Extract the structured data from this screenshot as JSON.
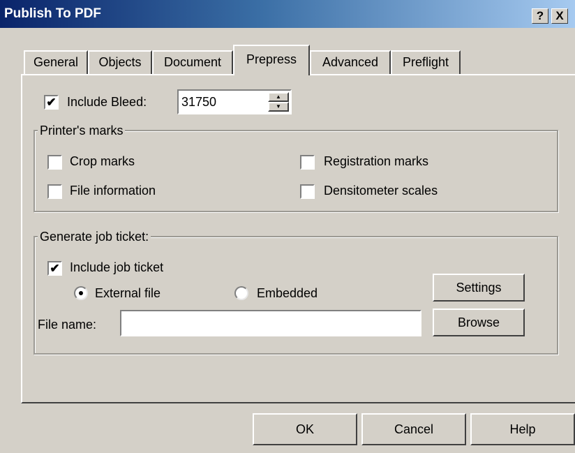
{
  "window": {
    "title": "Publish To PDF",
    "help_glyph": "?",
    "close_glyph": "X"
  },
  "tabs": [
    {
      "label": "General",
      "active": false
    },
    {
      "label": "Objects",
      "active": false
    },
    {
      "label": "Document",
      "active": false
    },
    {
      "label": "Prepress",
      "active": true
    },
    {
      "label": "Advanced",
      "active": false
    },
    {
      "label": "Preflight",
      "active": false
    }
  ],
  "bleed": {
    "label": "Include Bleed:",
    "checked": true,
    "value": "31750"
  },
  "printers_marks": {
    "title": "Printer's marks",
    "crop_marks": {
      "label": "Crop marks",
      "checked": false
    },
    "registration_marks": {
      "label": "Registration marks",
      "checked": false
    },
    "file_information": {
      "label": "File information",
      "checked": false
    },
    "densitometer_scales": {
      "label": "Densitometer scales",
      "checked": false
    }
  },
  "job_ticket": {
    "title": "Generate job ticket:",
    "include": {
      "label": "Include job ticket",
      "checked": true
    },
    "external": {
      "label": "External file",
      "selected": true
    },
    "embedded": {
      "label": "Embedded",
      "selected": false
    },
    "settings_label": "Settings",
    "file_name_label": "File name:",
    "file_name_value": "",
    "browse_label": "Browse"
  },
  "footer": {
    "ok_label": "OK",
    "cancel_label": "Cancel",
    "help_label": "Help"
  },
  "icons": {
    "checkmark": "✔",
    "spin_up": "▲",
    "spin_down": "▼"
  }
}
